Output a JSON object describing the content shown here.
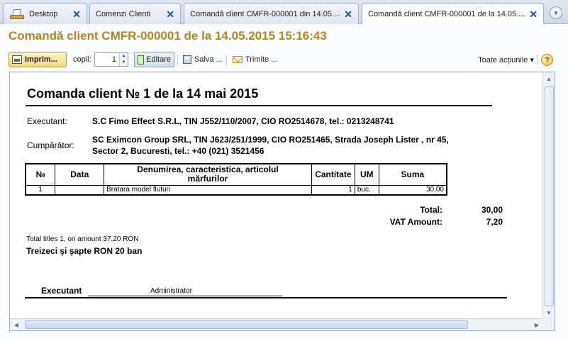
{
  "tabs": [
    {
      "label": "Desktop",
      "has_close": true
    },
    {
      "label": "Comenzi Clienti",
      "has_close": true
    },
    {
      "label": "Comandă client CMFR-000001 din 14.05....",
      "has_close": true
    },
    {
      "label": "Comandă client CMFR-000001 de la 14.05....",
      "has_close": true,
      "active": true
    }
  ],
  "window": {
    "title": "Comandă client CMFR-000001 de la 14.05.2015 15:16:43"
  },
  "toolbar": {
    "print_label": "Imprim...",
    "copies_label": "copii:",
    "copies_value": "1",
    "edit_label": "Editare",
    "save_label": "Salva ...",
    "send_label": "Trimite ...",
    "all_actions_label": "Toate acțiunile ▾",
    "help_label": "?"
  },
  "document": {
    "title": "Comanda client № 1 de la 14 mai 2015",
    "executant_label": "Executant:",
    "executant_value": "S.C Fimo Effect S.R.L,  TIN J552/110/2007,  CIO RO2514678,  tel.: 0213248741",
    "buyer_label": "Cumpărător:",
    "buyer_line1": "SC Eximcon Group SRL,  TIN J623/251/1999,  CIO RO251465,  Strada Joseph Lister , nr 45,",
    "buyer_line2": "Sector 2, Bucuresti,  tel.: +40 (021) 3521456",
    "table": {
      "headers": {
        "no": "№",
        "date": "Data",
        "name_line1": "Denumirea, caracteristica,  articolul",
        "name_line2": "mărfurilor",
        "qty": "Cantitate",
        "um": "UM",
        "sum": "Suma"
      },
      "rows": [
        {
          "no": "1",
          "date": "",
          "name": "Bratara model fluturi",
          "qty": "1",
          "um": "buc.",
          "sum": "30,00"
        }
      ]
    },
    "total_label": "Total:",
    "total_value": "30,00",
    "vat_label": "VAT Amount:",
    "vat_value": "7,20",
    "summary_small": "Total titles 1, on amount 37,20 RON",
    "amount_in_words": "Treizeci şi şapte RON 20 ban",
    "signature_label": "Executant",
    "signature_name": "Administrator"
  },
  "colors": {
    "title_accent": "#b4861c",
    "tab_close": "#1f4f8f"
  }
}
